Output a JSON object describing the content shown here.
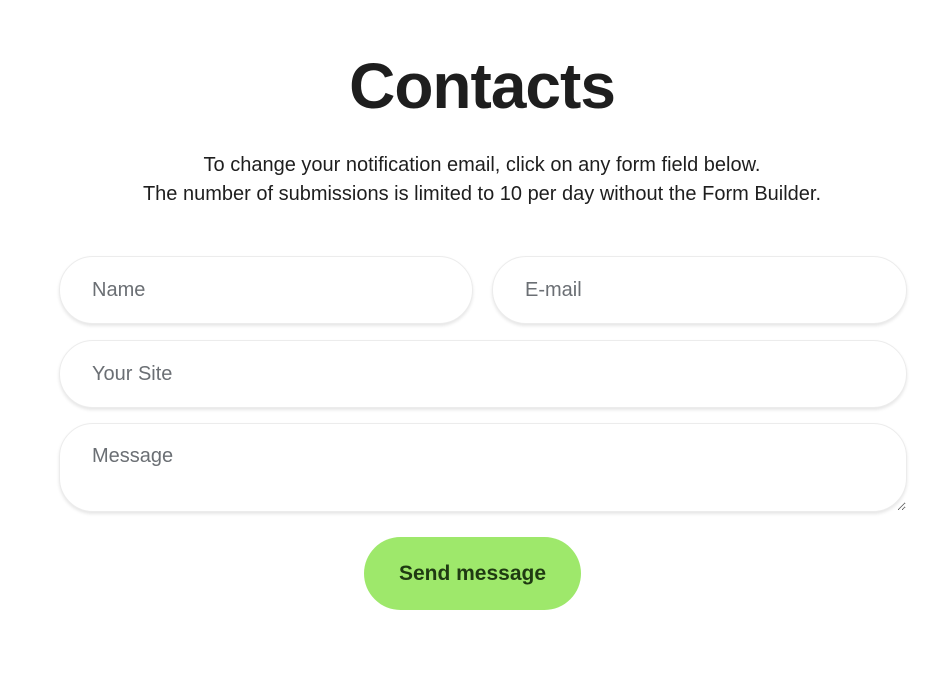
{
  "page": {
    "title": "Contacts",
    "subtitle_line1": "To change your notification email, click on any form field below.",
    "subtitle_line2": "The number of submissions is limited to 10 per day without the Form Builder."
  },
  "form": {
    "name": {
      "placeholder": "Name",
      "value": ""
    },
    "email": {
      "placeholder": "E-mail",
      "value": ""
    },
    "site": {
      "placeholder": "Your Site",
      "value": ""
    },
    "message": {
      "placeholder": "Message",
      "value": ""
    },
    "submit_label": "Send message"
  },
  "colors": {
    "button_background": "#9ee86b",
    "button_text": "#1f3a12",
    "title_text": "#1e1e1e",
    "placeholder_text": "#6b6f74"
  }
}
